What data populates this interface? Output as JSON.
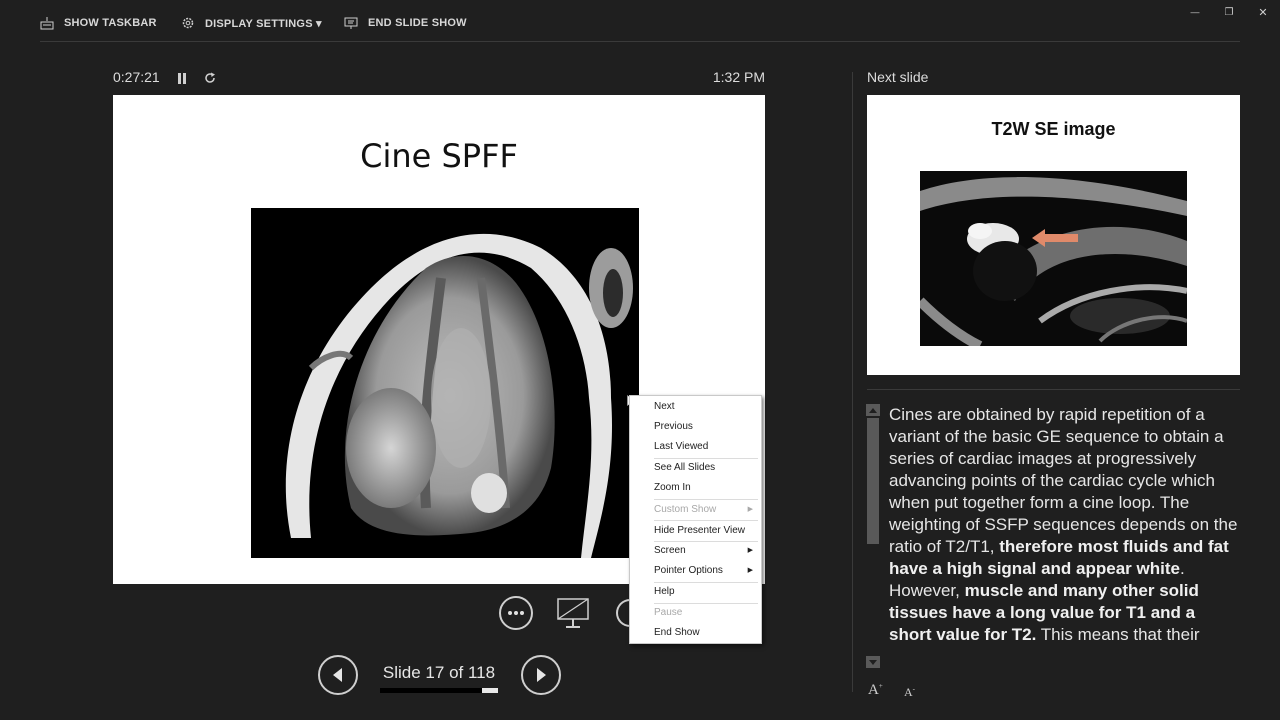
{
  "toolbar": {
    "show_taskbar": "SHOW TASKBAR",
    "display_settings": "DISPLAY SETTINGS ▾",
    "end_slide_show": "END SLIDE SHOW"
  },
  "window_controls": {
    "minimize": "—",
    "restore": "❐",
    "close": "✕"
  },
  "presenter": {
    "elapsed_time": "0:27:21",
    "clock": "1:32 PM",
    "current_slide": {
      "title": "Cine SPFF"
    },
    "slide_counter": "Slide 17 of 118",
    "progress_fraction": 0.144
  },
  "next_slide": {
    "label": "Next slide",
    "title": "T2W SE image"
  },
  "notes": {
    "p1_a": "Cines are obtained by rapid repetition of a variant of the basic GE sequence to obtain a series of cardiac images at progressively advancing points of the cardiac cycle which when put together form a cine loop. The weighting of SSFP sequences depends on the ratio of T2/T1, ",
    "p1_b": "therefore most fluids and fat have a high signal and appear white",
    "p1_c": ".",
    "p2_a": "However, ",
    "p2_b": "muscle and many other solid tissues have a long value for T1 and a short value for T2.",
    "p2_c": " This means that their"
  },
  "context_menu": {
    "items": [
      {
        "label": "Next"
      },
      {
        "label": "Previous"
      },
      {
        "label": "Last Viewed"
      },
      {
        "label": "See All Slides"
      },
      {
        "label": "Zoom In"
      },
      {
        "label": "Custom Show"
      },
      {
        "label": "Hide Presenter View"
      },
      {
        "label": "Screen"
      },
      {
        "label": "Pointer Options"
      },
      {
        "label": "Help"
      },
      {
        "label": "Pause"
      },
      {
        "label": "End Show"
      }
    ]
  },
  "colors": {
    "background": "#1f1f1f",
    "text": "#e6e6e6",
    "menu_bg": "#ffffff",
    "arrow_accent": "#e08a6a"
  },
  "icons": [
    "keyboard-icon",
    "gear-icon",
    "presentation-icon",
    "pause-icon",
    "restart-icon",
    "more-icon",
    "screen-icon",
    "prev-arrow-icon",
    "next-arrow-icon",
    "increase-font-icon",
    "decrease-font-icon"
  ]
}
